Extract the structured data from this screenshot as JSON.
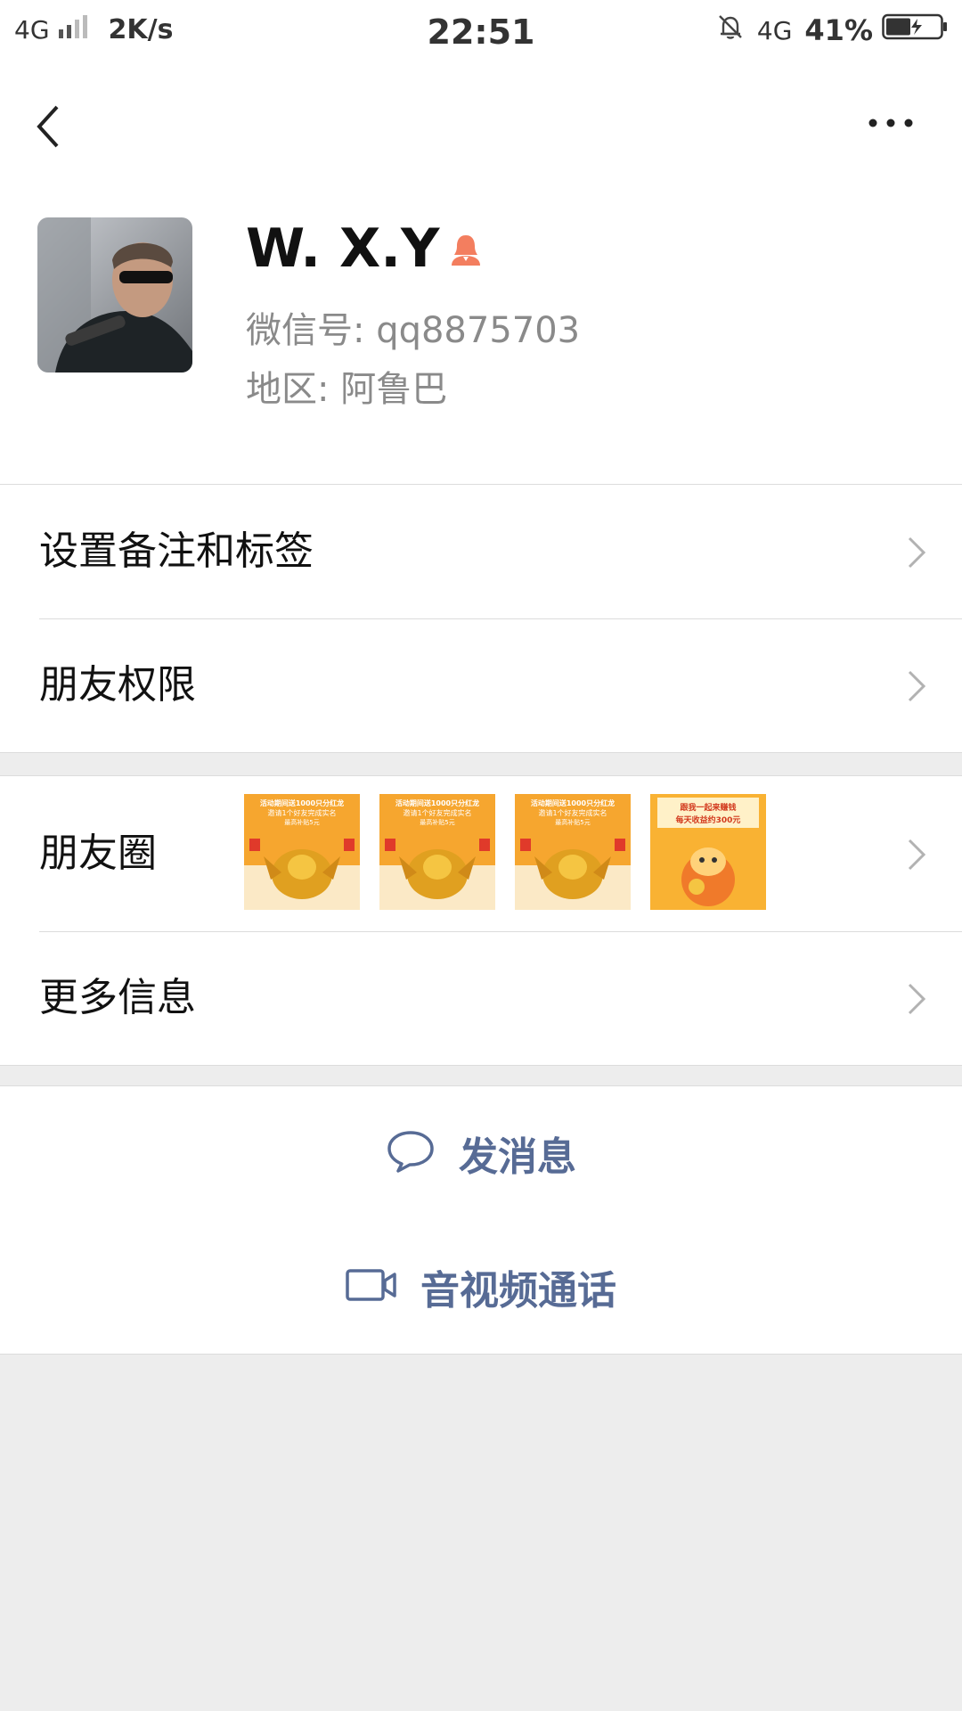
{
  "status_bar": {
    "network": "4G",
    "speed": "2K/s",
    "time": "22:51",
    "network_right": "4G",
    "battery": "41%"
  },
  "profile": {
    "nickname": "W. X.Y",
    "wechat_id": "微信号:  qq8875703",
    "region": "地区:  阿鲁巴",
    "gender_icon": "female-icon",
    "gender_color": "#f37e5f"
  },
  "menu": {
    "remark_tags": "设置备注和标签",
    "friend_permissions": "朋友权限",
    "moments": "朋友圈",
    "more_info": "更多信息"
  },
  "moments_thumbs": [
    {
      "line1": "活动期间送1000只分红龙",
      "line2": "邀请1个好友完成实名",
      "line3": "最高补贴5元"
    },
    {
      "line1": "活动期间送1000只分红龙",
      "line2": "邀请1个好友完成实名",
      "line3": "最高补贴5元"
    },
    {
      "line1": "活动期间送1000只分红龙",
      "line2": "邀请1个好友完成实名",
      "line3": "最高补贴5元"
    },
    {
      "line1": "跟我一起来赚钱",
      "line2": "每天收益约300元",
      "line3": ""
    }
  ],
  "actions": {
    "send_message": "发消息",
    "video_call": "音视频通话"
  },
  "colors": {
    "accent": "#576b95",
    "background": "#ededed"
  }
}
